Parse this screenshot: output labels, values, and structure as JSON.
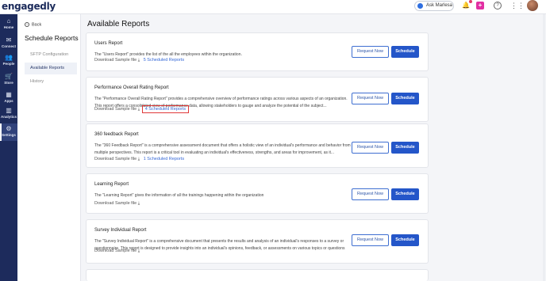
{
  "topbar": {
    "logo": "engagedly",
    "ask_label": "Ask Marlesa",
    "icons": [
      "bell-icon",
      "plus-icon",
      "help-icon",
      "apps-grid-icon"
    ],
    "plus_symbol": "+",
    "help_symbol": "?",
    "grid_symbol": "⋮⋮"
  },
  "leftnav": {
    "items": [
      {
        "label": "Home",
        "icon": "home-icon",
        "glyph": "⌂"
      },
      {
        "label": "Connect",
        "icon": "connect-icon",
        "glyph": "✉"
      },
      {
        "label": "People",
        "icon": "people-icon",
        "glyph": "👥"
      },
      {
        "label": "Store",
        "icon": "store-icon",
        "glyph": "🛒"
      },
      {
        "label": "Apps",
        "icon": "apps-icon",
        "glyph": "▦"
      },
      {
        "label": "Analytics",
        "icon": "analytics-icon",
        "glyph": "▥"
      },
      {
        "label": "Settings",
        "icon": "settings-icon",
        "glyph": "⚙"
      }
    ],
    "active": "Settings"
  },
  "sidebar": {
    "back_label": "Back",
    "title": "Schedule Reports",
    "items": [
      {
        "label": "SFTP Configuration"
      },
      {
        "label": "Available Reports"
      },
      {
        "label": "History"
      }
    ],
    "active": "Available Reports"
  },
  "main": {
    "title": "Available Reports",
    "request_label": "Request Now",
    "schedule_label": "Schedule",
    "reports": [
      {
        "title": "Users Report",
        "desc": "The \"Users Report\" provides the list of the all the employees within the organization.",
        "download": "Download Sample file",
        "scheduled": "5 Scheduled Reports"
      },
      {
        "title": "Performance Overall Rating Report",
        "desc": "The \"Performance Overall Rating Report\" provides a comprehensive overview of performance ratings across various aspects of an organization. This report offers a consolidated view of performance data, allowing stakeholders to gauge and analyze the potential of the subject...",
        "download": "Download Sample file",
        "scheduled": "4 Scheduled Reports"
      },
      {
        "title": "360 feedback Report",
        "desc": "The \"360 Feedback Report\" is a comprehensive assessment document that offers a holistic view of an individual's performance and behavior from multiple perspectives. This report is a critical tool in evaluating an individual's effectiveness, strengths, and areas for improvement, as it...",
        "download": "Download Sample file",
        "scheduled": "1 Scheduled Reports"
      },
      {
        "title": "Learning Report",
        "desc": "The \"Learning Report\" gives the information of all the trainings happening within the organization",
        "download": "Download Sample file",
        "scheduled": ""
      },
      {
        "title": "Survey Individual Report",
        "desc": "The \"Survey Individual Report\" is a comprehensive document that presents the results and analysis of an individual's responses to a survey or questionnaire. This report is designed to provide insights into an individual's opinions, feedback, or assessments on various topics or questions",
        "download": "Download Sample file",
        "scheduled": ""
      }
    ]
  },
  "colors": {
    "nav_bg": "#1d2b5c",
    "primary": "#2456c9",
    "link": "#3467d6",
    "highlight_box": "#e0393a"
  }
}
